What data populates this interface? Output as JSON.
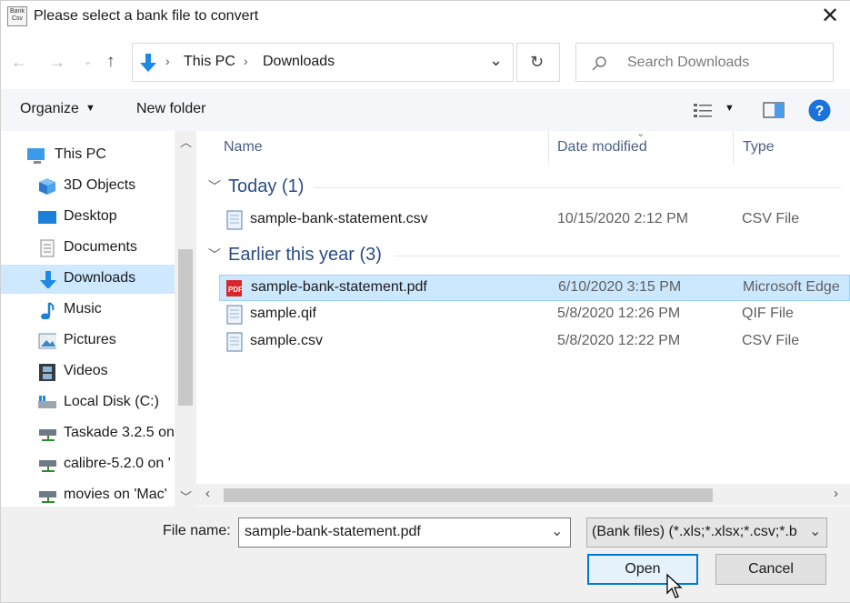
{
  "window": {
    "title": "Please select a bank file to convert",
    "app_icon_text": "Bank Csv"
  },
  "address": {
    "crumbs": [
      "This PC",
      "Downloads"
    ],
    "search_placeholder": "Search Downloads"
  },
  "toolbar": {
    "organize": "Organize",
    "new_folder": "New folder"
  },
  "nav": {
    "items": [
      {
        "label": "This PC",
        "icon": "pc-icon"
      },
      {
        "label": "3D Objects",
        "icon": "cube-icon"
      },
      {
        "label": "Desktop",
        "icon": "desktop-icon"
      },
      {
        "label": "Documents",
        "icon": "document-icon"
      },
      {
        "label": "Downloads",
        "icon": "download-icon",
        "selected": true
      },
      {
        "label": "Music",
        "icon": "music-icon"
      },
      {
        "label": "Pictures",
        "icon": "pictures-icon"
      },
      {
        "label": "Videos",
        "icon": "video-icon"
      },
      {
        "label": "Local Disk (C:)",
        "icon": "disk-icon"
      },
      {
        "label": "Taskade 3.2.5 on",
        "icon": "network-drive-icon"
      },
      {
        "label": "calibre-5.2.0 on '",
        "icon": "network-drive-icon"
      },
      {
        "label": "movies on 'Mac'",
        "icon": "network-drive-icon"
      }
    ]
  },
  "columns": {
    "name": "Name",
    "date": "Date modified",
    "type": "Type"
  },
  "groups": [
    {
      "label": "Today (1)",
      "files": [
        {
          "name": "sample-bank-statement.csv",
          "date": "10/15/2020 2:12 PM",
          "type": "CSV File",
          "icon": "csv-file-icon"
        }
      ]
    },
    {
      "label": "Earlier this year (3)",
      "files": [
        {
          "name": "sample-bank-statement.pdf",
          "date": "6/10/2020 3:15 PM",
          "type": "Microsoft Edge",
          "icon": "pdf-file-icon",
          "selected": true
        },
        {
          "name": "sample.qif",
          "date": "5/8/2020 12:26 PM",
          "type": "QIF File",
          "icon": "qif-file-icon"
        },
        {
          "name": "sample.csv",
          "date": "5/8/2020 12:22 PM",
          "type": "CSV File",
          "icon": "csv-file-icon"
        }
      ]
    }
  ],
  "footer": {
    "file_name_label": "File name:",
    "file_name_value": "sample-bank-statement.pdf",
    "filter_value": "(Bank files) (*.xls;*.xlsx;*.csv;*.b",
    "open_label": "Open",
    "cancel_label": "Cancel"
  },
  "colors": {
    "accent": "#0078d7",
    "selection": "#cce8ff",
    "group_header": "#2a4d85",
    "pdf_red": "#d9262b"
  }
}
